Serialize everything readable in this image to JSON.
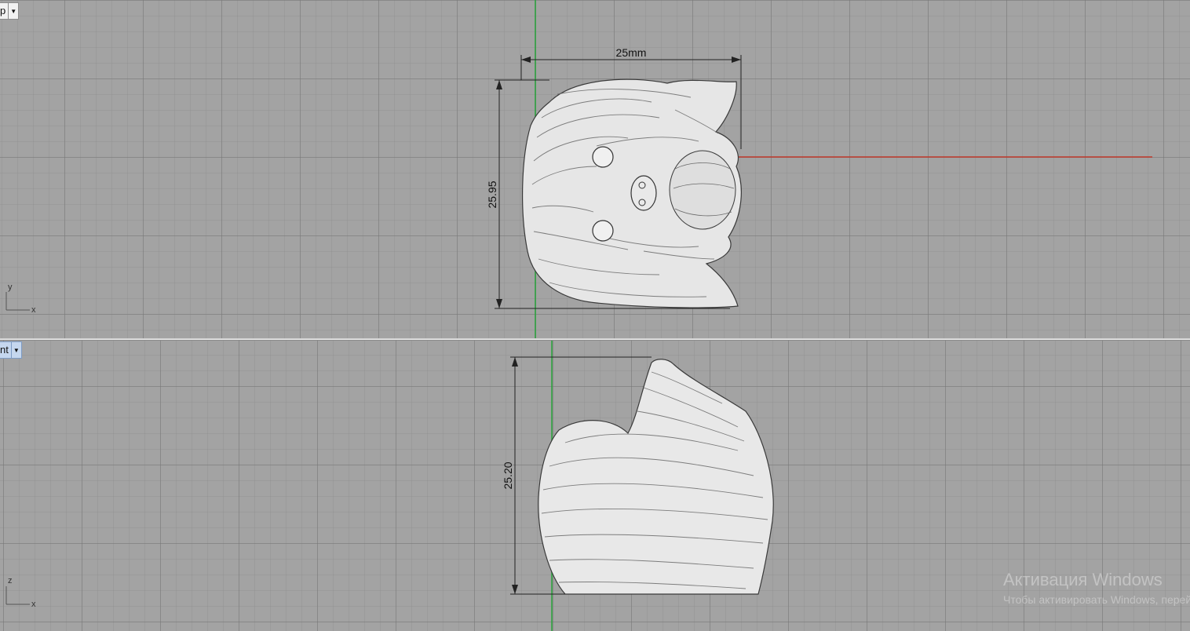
{
  "viewports": {
    "top": {
      "label": "Top",
      "label_visible": "p",
      "axes": {
        "v": "y",
        "h": "x"
      }
    },
    "front": {
      "label": "Front",
      "label_visible": "nt",
      "axes": {
        "v": "z",
        "h": "x"
      }
    }
  },
  "dimensions": {
    "top_width": "25mm",
    "top_height": "25.95",
    "front_height": "25.20"
  },
  "colors": {
    "x_axis": "#c0392b",
    "y_axis": "#27a33a",
    "active_label": "#c5d7ee"
  },
  "watermark": {
    "title": "Активация Windows",
    "subtitle": "Чтобы активировать Windows, перейдите в раздел «Параметры»."
  }
}
